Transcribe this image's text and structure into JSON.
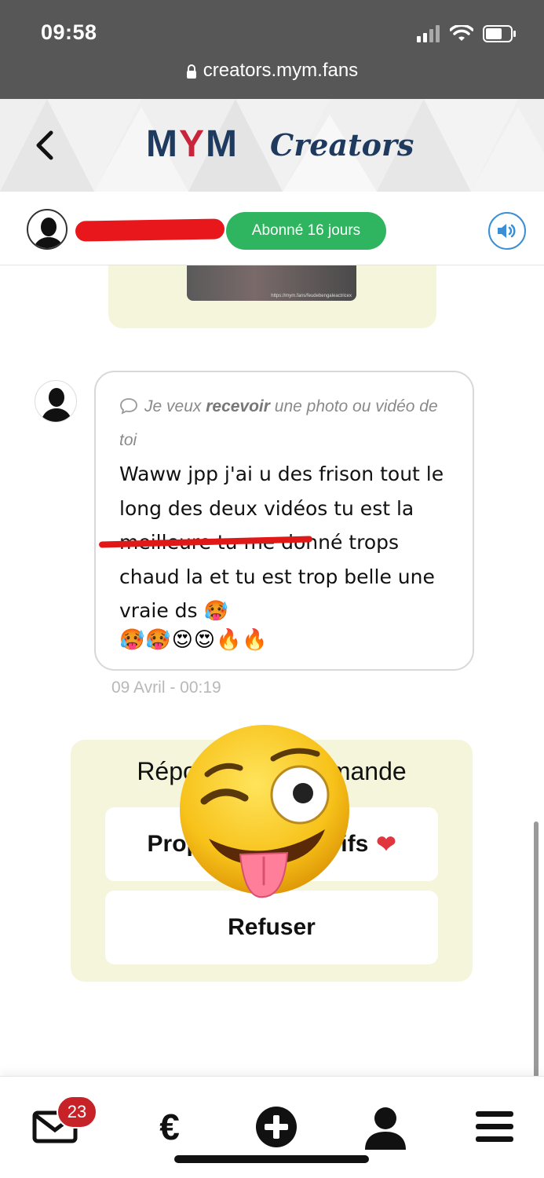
{
  "status_bar": {
    "time": "09:58"
  },
  "browser": {
    "url": "creators.mym.fans"
  },
  "header": {
    "logo_m1": "M",
    "logo_y": "Y",
    "logo_m2": "M",
    "logo_suffix": "Creators"
  },
  "user_bar": {
    "subscription_badge": "Abonné 16 jours"
  },
  "previous_media": {
    "watermark": "https://mym.fans/feudebengaleactricex"
  },
  "message": {
    "request_prefix": "Je veux ",
    "request_bold": "recevoir",
    "request_suffix": " une photo ou vidéo de toi",
    "text": "Waww jpp j'ai u des frison tout le long des deux vidéos tu est la meilleure tu me donné trops chaud la et tu est trop belle une vraie ds 🥵",
    "emojis": "🥵🥵😍😍🔥🔥",
    "timestamp": "09 Avril - 00:19"
  },
  "response": {
    "title": "Répondre à la demande",
    "propose_label": "Proposer mes tarifs",
    "heart": "❤",
    "refuse_label": "Refuser"
  },
  "bottom_nav": {
    "mail_badge": "23",
    "euro": "€"
  },
  "colors": {
    "accent_green": "#2fb55f",
    "badge_red": "#c82229",
    "card_bg": "#f5f5dc",
    "logo_blue": "#1e3a5f",
    "logo_red": "#c8243b"
  }
}
